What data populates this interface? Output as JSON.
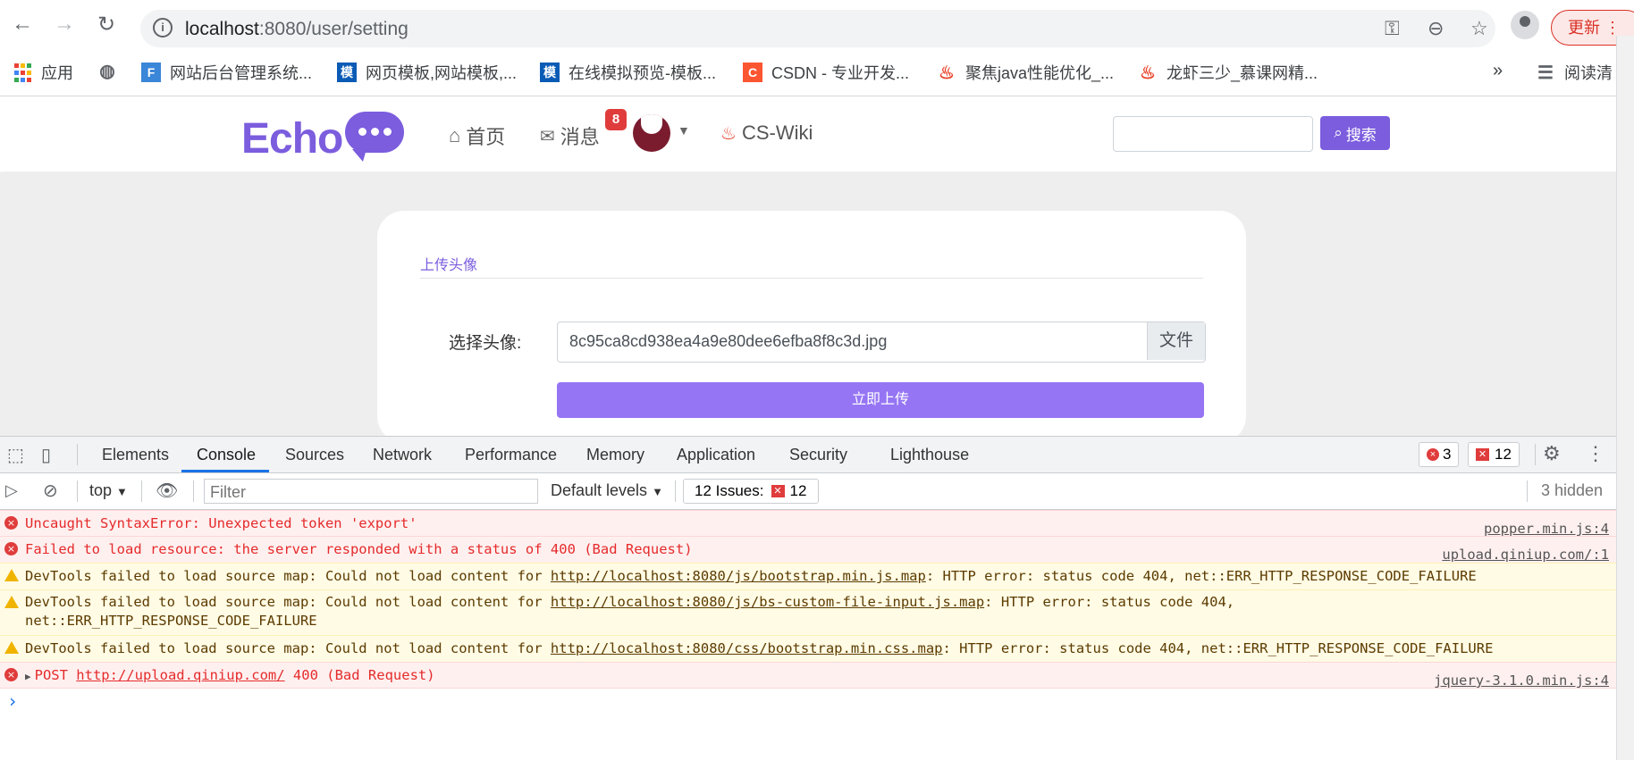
{
  "browser": {
    "url_host": "localhost",
    "url_rest": ":8080/user/setting",
    "update_label": "更新",
    "colors": {
      "update_red": "#d93025"
    }
  },
  "bookmarks": [
    {
      "label": "应用",
      "icon": "apps-grid-icon"
    },
    {
      "label": "",
      "icon": "globe-icon"
    },
    {
      "label": "网站后台管理系统...",
      "icon": "site-favicon"
    },
    {
      "label": "网页模板,网站模板,...",
      "icon": "mo-favicon",
      "badge": "模"
    },
    {
      "label": "在线模拟预览-模板...",
      "icon": "mo-favicon",
      "badge": "模"
    },
    {
      "label": "CSDN - 专业开发...",
      "icon": "csdn-favicon",
      "badge": "C"
    },
    {
      "label": "聚焦java性能优化_...",
      "icon": "flame-icon"
    },
    {
      "label": "龙虾三少_慕课网精...",
      "icon": "flame-icon"
    },
    {
      "label": "»",
      "icon": "more-bookmarks-icon"
    },
    {
      "label": "阅读清",
      "icon": "reading-list-icon"
    }
  ],
  "site": {
    "logo": "Echo",
    "nav": {
      "home": "首页",
      "messages": "消息",
      "message_count": "8",
      "wiki": "CS-Wiki"
    },
    "search_button": "搜索",
    "search_placeholder": "",
    "accent": "#7b5dde"
  },
  "card": {
    "title": "上传头像",
    "avatar_label": "选择头像:",
    "file_name": "8c95ca8cd938ea4a9e80dee6efba8f8c3d.jpg",
    "file_button": "文件",
    "upload_button": "立即上传"
  },
  "devtools": {
    "tabs": [
      "Elements",
      "Console",
      "Sources",
      "Network",
      "Performance",
      "Memory",
      "Application",
      "Security",
      "Lighthouse"
    ],
    "active_tab": "Console",
    "error_count": "3",
    "issue_count": "12",
    "toolbar": {
      "context": "top",
      "filter_placeholder": "Filter",
      "levels": "Default levels",
      "issues_label": "12 Issues:",
      "issues_count": "12",
      "hidden": "3 hidden"
    },
    "console": [
      {
        "level": "error",
        "text": "Uncaught SyntaxError: Unexpected token 'export'",
        "source": "popper.min.js:4"
      },
      {
        "level": "error",
        "text": "Failed to load resource: the server responded with a status of 400 (Bad Request)",
        "source": "upload.qiniup.com/:1"
      },
      {
        "level": "warning",
        "pre": "DevTools failed to load source map: Could not load content for ",
        "link": "http://localhost:8080/js/bootstrap.min.js.map",
        "post": ": HTTP error: status code 404, net::ERR_HTTP_RESPONSE_CODE_FAILURE"
      },
      {
        "level": "warning",
        "pre": "DevTools failed to load source map: Could not load content for ",
        "link": "http://localhost:8080/js/bs-custom-file-input.js.map",
        "post": ": HTTP error: status code 404,",
        "line2": "net::ERR_HTTP_RESPONSE_CODE_FAILURE"
      },
      {
        "level": "warning",
        "pre": "DevTools failed to load source map: Could not load content for ",
        "link": "http://localhost:8080/css/bootstrap.min.css.map",
        "post": ": HTTP error: status code 404, net::ERR_HTTP_RESPONSE_CODE_FAILURE"
      },
      {
        "level": "error",
        "pre": "POST ",
        "link": "http://upload.qiniup.com/",
        "post": " 400 (Bad Request)",
        "source": "jquery-3.1.0.min.js:4"
      }
    ],
    "prompt": "›"
  }
}
